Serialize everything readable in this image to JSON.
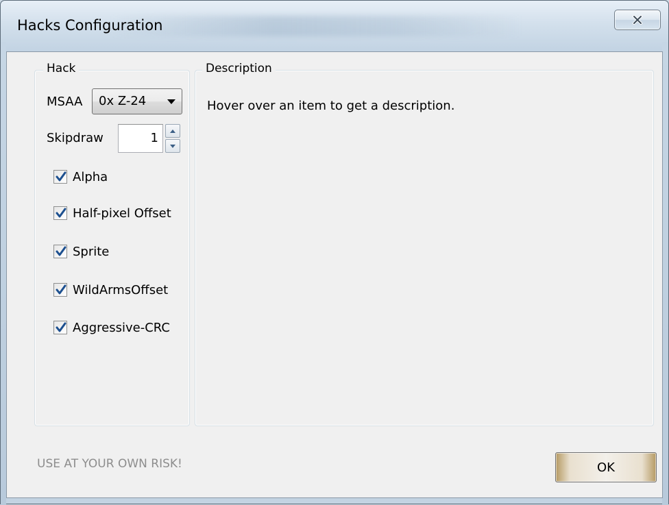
{
  "window": {
    "title": "Hacks Configuration",
    "close_icon": "close-icon"
  },
  "hack_group": {
    "legend": "Hack",
    "msaa": {
      "label": "MSAA",
      "selected": "0x Z-24"
    },
    "skipdraw": {
      "label": "Skipdraw",
      "value": "1"
    },
    "checkboxes": [
      {
        "label": "Alpha",
        "checked": true
      },
      {
        "label": "Half-pixel Offset",
        "checked": true
      },
      {
        "label": "Sprite",
        "checked": true
      },
      {
        "label": "WildArmsOffset",
        "checked": true
      },
      {
        "label": "Aggressive-CRC",
        "checked": true
      }
    ]
  },
  "description_group": {
    "legend": "Description",
    "text": "Hover over an item to get a description."
  },
  "footer": {
    "warning": "USE AT YOUR OWN RISK!",
    "ok_label": "OK"
  },
  "colors": {
    "check_blue": "#1c4f8f",
    "ok_gold": "#b59a63",
    "warning_gray": "#8d8d8d"
  }
}
